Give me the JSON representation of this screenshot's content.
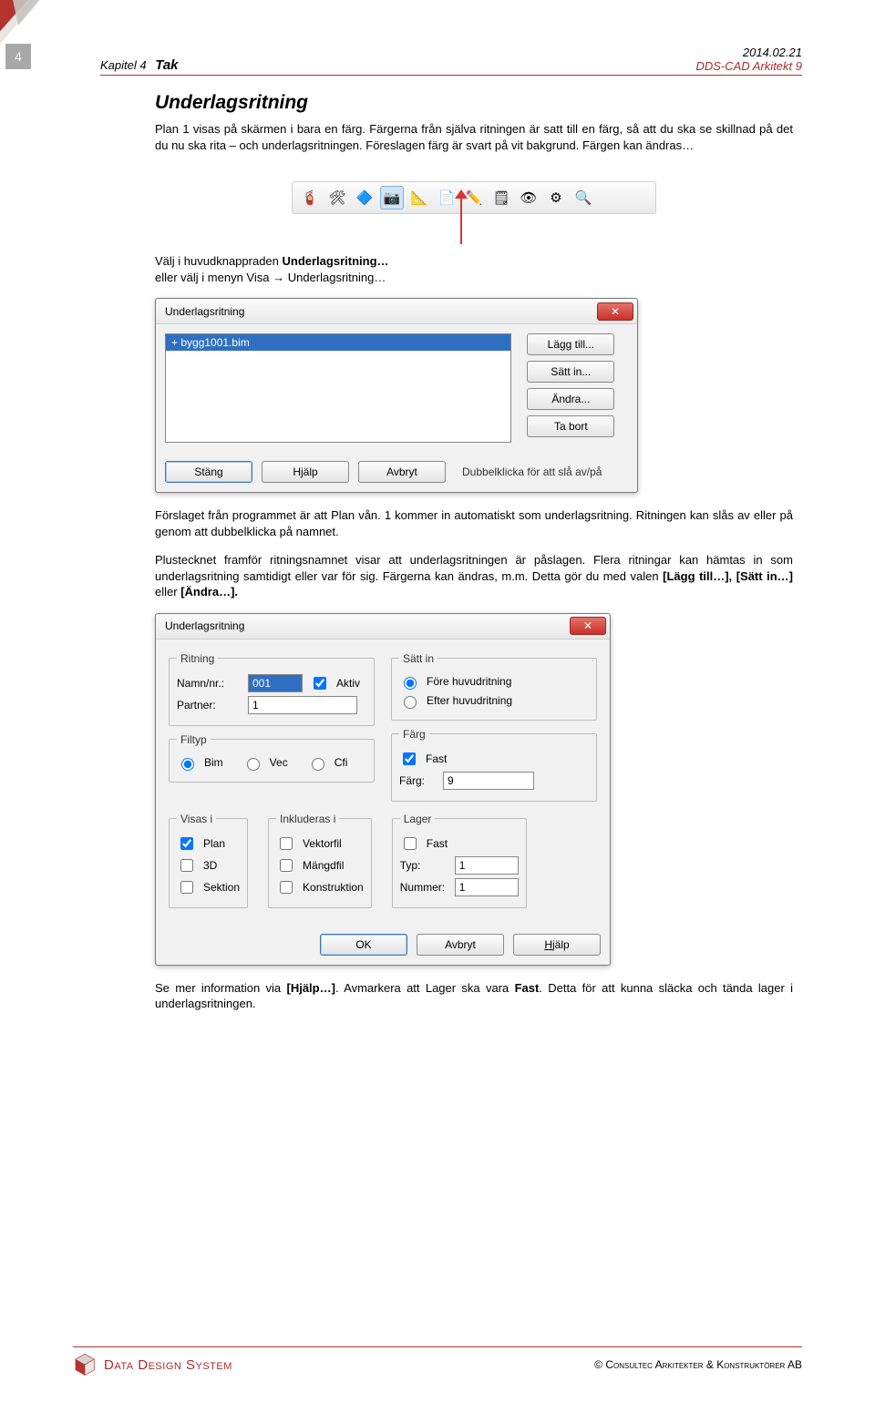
{
  "page_number": "4",
  "header": {
    "chapter": "Kapitel 4",
    "title": "Tak",
    "date": "2014.02.21",
    "product": "DDS-CAD Arkitekt 9"
  },
  "section_title": "Underlagsritning",
  "para1": "Plan 1 visas på skärmen i bara en färg. Färgerna från själva ritningen är satt till en färg, så att du ska se skillnad på det du nu ska rita – och underlagsritningen. Föreslagen färg är svart på vit bakgrund. Färgen kan ändras…",
  "toolbar_icons": [
    "🧯",
    "🛠",
    "🔷",
    "📷",
    "📐",
    "📄",
    "✏️",
    "🗒",
    "👁",
    "⚙",
    "🔍"
  ],
  "para2_a": "Välj i huvudknappraden ",
  "para2_b": "Underlagsritning…",
  "para2_c": "eller välj i menyn Visa → Underlagsritning…",
  "dlg1": {
    "title": "Underlagsritning",
    "item": "+ bygg1001.bim",
    "btns": {
      "lagg": "Lägg till...",
      "satt": "Sätt in...",
      "andra": "Ändra...",
      "tabort": "Ta bort"
    },
    "footer": {
      "stang": "Stäng",
      "hjalp": "Hjälp",
      "avbryt": "Avbryt",
      "note": "Dubbelklicka för att slå av/på"
    }
  },
  "para3": "Förslaget från programmet är att Plan vån. 1 kommer in automatiskt som underlagsritning. Ritningen kan slås av eller på genom att dubbelklicka på namnet.",
  "para4_a": "Plustecknet framför ritningsnamnet visar att underlagsritningen är påslagen. Flera ritningar kan hämtas in som underlagsritning samtidigt eller var för sig. Färgerna kan ändras, m.m. Detta gör du med valen ",
  "para4_b": "[Lägg till…], [Sätt in…]",
  "para4_c": " eller ",
  "para4_d": "[Ändra…].",
  "dlg2": {
    "title": "Underlagsritning",
    "ritning": {
      "legend": "Ritning",
      "namn_label": "Namn/nr.:",
      "namn_value": "001",
      "aktiv": "Aktiv",
      "partner_label": "Partner:",
      "partner_value": "1"
    },
    "sattin": {
      "legend": "Sätt in",
      "fore": "Före huvudritning",
      "efter": "Efter huvudritning"
    },
    "filtyp": {
      "legend": "Filtyp",
      "bim": "Bim",
      "vec": "Vec",
      "cfi": "Cfi"
    },
    "farg": {
      "legend": "Färg",
      "fast": "Fast",
      "farg_label": "Färg:",
      "farg_value": "9"
    },
    "visas": {
      "legend": "Visas i",
      "plan": "Plan",
      "3d": "3D",
      "sektion": "Sektion"
    },
    "inkl": {
      "legend": "Inkluderas i",
      "vektor": "Vektorfil",
      "mangd": "Mängdfil",
      "konstr": "Konstruktion"
    },
    "lager": {
      "legend": "Lager",
      "fast": "Fast",
      "typ_label": "Typ:",
      "typ_value": "1",
      "nummer_label": "Nummer:",
      "nummer_value": "1"
    },
    "footer": {
      "ok": "OK",
      "avbryt": "Avbryt",
      "hjalp": "Hjälp"
    }
  },
  "para5_a": "Se mer information via ",
  "para5_b": "[Hjälp…]",
  "para5_c": ". Avmarkera att Lager ska vara ",
  "para5_d": "Fast",
  "para5_e": ". Detta för att kunna släcka och tända lager i underlagsritningen.",
  "footer": {
    "brand": "Data Design System",
    "copyright": "©  Consultec Arkitekter & Konstruktörer AB"
  }
}
